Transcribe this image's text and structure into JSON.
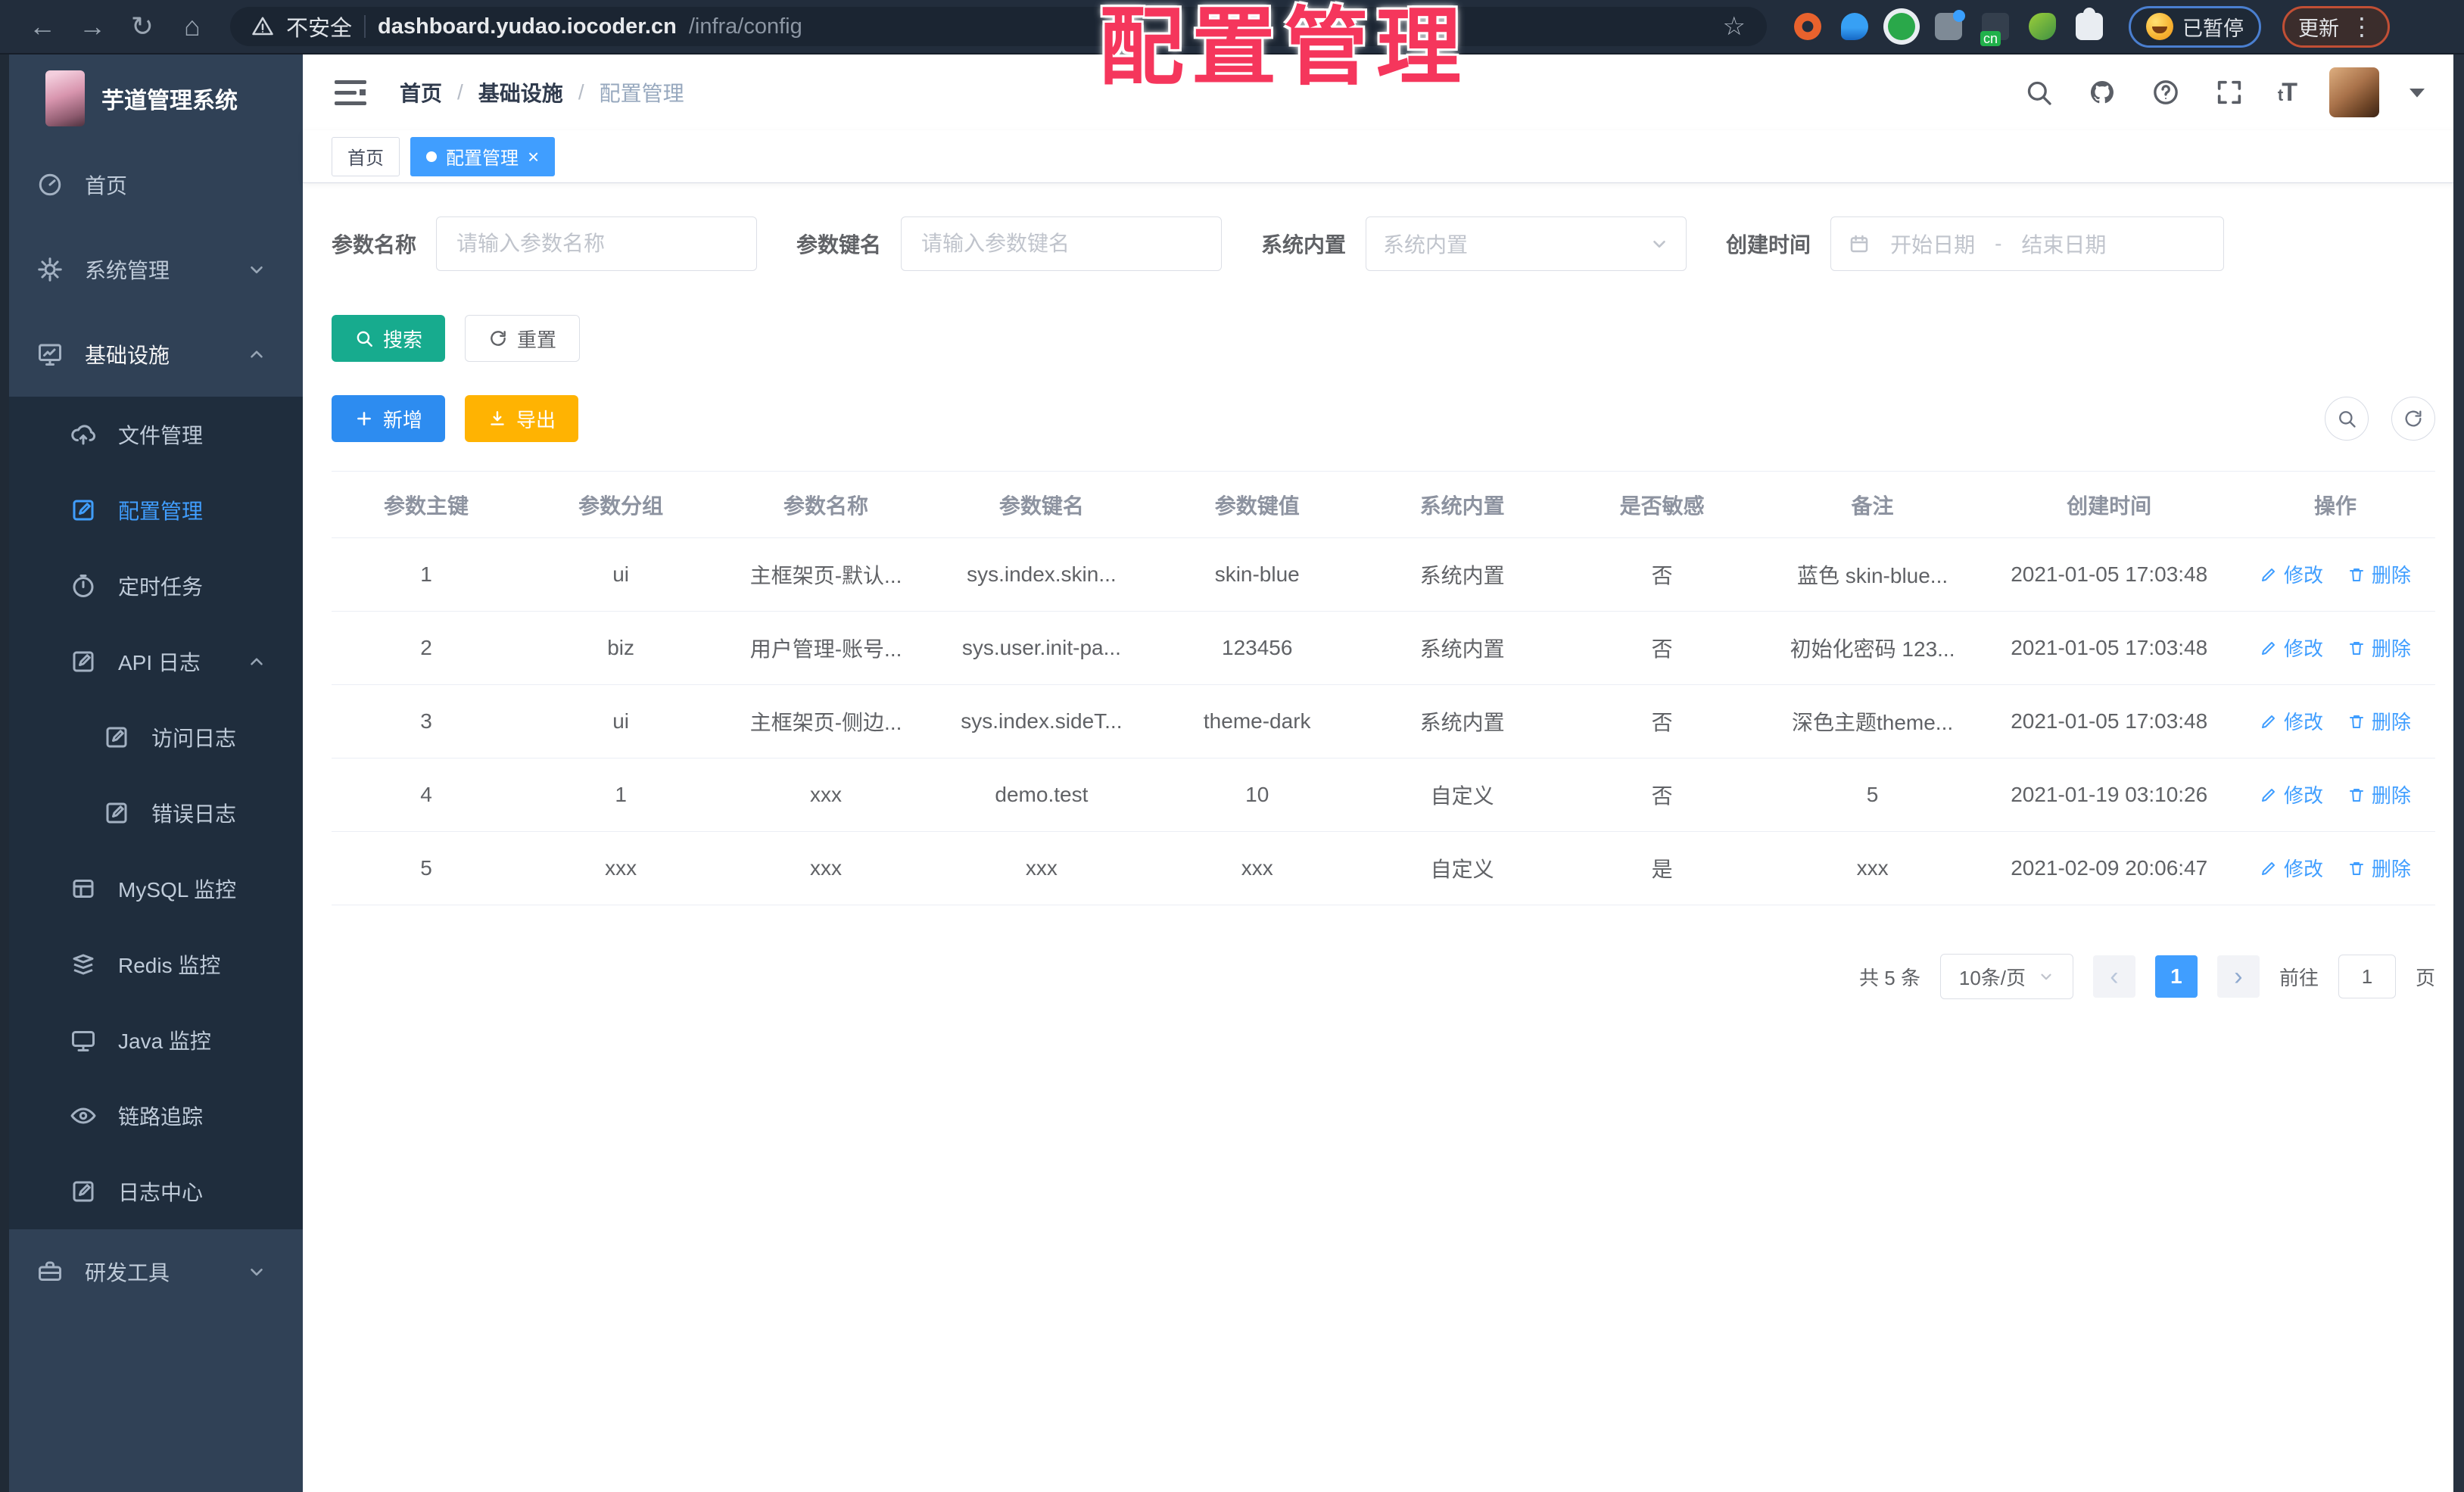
{
  "browser": {
    "security_label": "不安全",
    "url_host": "dashboard.yudao.iocoder.cn",
    "url_path": "/infra/config",
    "paused_label": "已暂停",
    "update_label": "更新"
  },
  "overlay": {
    "title": "配置管理"
  },
  "app": {
    "title": "芋道管理系统"
  },
  "colors": {
    "accent": "#409eff",
    "search_button": "#17ab8e",
    "add_button": "#2d8cf0",
    "export_button": "#ffb302",
    "sidebar_bg": "#304156",
    "submenu_bg": "#1f2d3d",
    "overlay_red": "#f5365c"
  },
  "sidebar": {
    "items": [
      {
        "label": "首页"
      },
      {
        "label": "系统管理"
      },
      {
        "label": "基础设施"
      },
      {
        "label": "文件管理"
      },
      {
        "label": "配置管理"
      },
      {
        "label": "定时任务"
      },
      {
        "label": "API 日志"
      },
      {
        "label": "访问日志"
      },
      {
        "label": "错误日志"
      },
      {
        "label": "MySQL 监控"
      },
      {
        "label": "Redis 监控"
      },
      {
        "label": "Java 监控"
      },
      {
        "label": "链路追踪"
      },
      {
        "label": "日志中心"
      },
      {
        "label": "研发工具"
      }
    ]
  },
  "breadcrumb": {
    "items": [
      "首页",
      "基础设施",
      "配置管理"
    ],
    "separator": "/"
  },
  "tags": {
    "home": "首页",
    "active": "配置管理"
  },
  "filters": {
    "name_label": "参数名称",
    "name_placeholder": "请输入参数名称",
    "key_label": "参数键名",
    "key_placeholder": "请输入参数键名",
    "type_label": "系统内置",
    "type_placeholder": "系统内置",
    "date_label": "创建时间",
    "date_start": "开始日期",
    "date_separator": "-",
    "date_end": "结束日期"
  },
  "actions": {
    "search": "搜索",
    "reset": "重置",
    "add": "新增",
    "export": "导出"
  },
  "table": {
    "headers": [
      "参数主键",
      "参数分组",
      "参数名称",
      "参数键名",
      "参数键值",
      "系统内置",
      "是否敏感",
      "备注",
      "创建时间",
      "操作"
    ],
    "edit_label": "修改",
    "delete_label": "删除",
    "rows": [
      {
        "id": "1",
        "group": "ui",
        "name": "主框架页-默认...",
        "key": "sys.index.skin...",
        "value": "skin-blue",
        "type": "系统内置",
        "sensitive": "否",
        "remark": "蓝色 skin-blue...",
        "created": "2021-01-05 17:03:48"
      },
      {
        "id": "2",
        "group": "biz",
        "name": "用户管理-账号...",
        "key": "sys.user.init-pa...",
        "value": "123456",
        "type": "系统内置",
        "sensitive": "否",
        "remark": "初始化密码 123...",
        "created": "2021-01-05 17:03:48"
      },
      {
        "id": "3",
        "group": "ui",
        "name": "主框架页-侧边...",
        "key": "sys.index.sideT...",
        "value": "theme-dark",
        "type": "系统内置",
        "sensitive": "否",
        "remark": "深色主题theme...",
        "created": "2021-01-05 17:03:48"
      },
      {
        "id": "4",
        "group": "1",
        "name": "xxx",
        "key": "demo.test",
        "value": "10",
        "type": "自定义",
        "sensitive": "否",
        "remark": "5",
        "created": "2021-01-19 03:10:26"
      },
      {
        "id": "5",
        "group": "xxx",
        "name": "xxx",
        "key": "xxx",
        "value": "xxx",
        "type": "自定义",
        "sensitive": "是",
        "remark": "xxx",
        "created": "2021-02-09 20:06:47"
      }
    ]
  },
  "pagination": {
    "total": "共 5 条",
    "page_size": "10条/页",
    "current": "1",
    "goto_label": "前往",
    "goto_value": "1",
    "page_label": "页"
  }
}
